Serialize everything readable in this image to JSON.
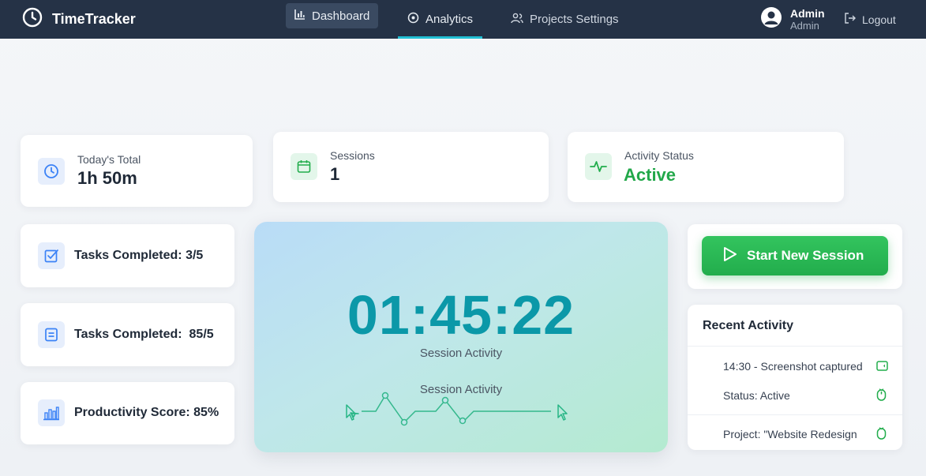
{
  "app": {
    "name": "TimeTracker"
  },
  "nav": {
    "tabs": [
      {
        "label": "Dashboard",
        "icon": "bar-chart-icon"
      },
      {
        "label": "Analytics",
        "icon": "target-icon",
        "active": true
      },
      {
        "label": "Projects Settings",
        "icon": "users-icon"
      }
    ],
    "user": {
      "name": "Admin",
      "role": "Admin"
    },
    "logout_label": "Logout"
  },
  "stats": {
    "today_total": {
      "label": "Today's Total",
      "value": "1h 50m"
    },
    "sessions": {
      "label": "Sessions",
      "value": "1"
    },
    "activity_status": {
      "label": "Activity Status",
      "value": "Active"
    }
  },
  "side_metrics": [
    {
      "label": "Tasks Completed: 3/5",
      "icon": "check-square-icon"
    },
    {
      "label": "Tasks Completed:  85/5",
      "icon": "list-icon"
    },
    {
      "label": "Productivity Score: 85%",
      "icon": "bar-chart-icon"
    }
  ],
  "timer": {
    "display": "01:45:22",
    "caption": "Session Activity",
    "sparkline_caption": "Session Activity"
  },
  "start_button": {
    "label": "Start New Session"
  },
  "recent_activity": {
    "title": "Recent Activity",
    "items": [
      {
        "text": "14:30 - Screenshot captured",
        "icon": "camera-icon"
      },
      {
        "text": "Status: Active",
        "icon": "mouse-icon"
      },
      {
        "text": "Project: \"Website Redesign",
        "icon": "mouse-icon"
      }
    ]
  },
  "colors": {
    "nav_bg": "#253246",
    "accent_cyan": "#22c0d4",
    "timer_text": "#0b98a8",
    "success_green": "#22ad4c",
    "icon_blue": "#3b82f6"
  }
}
